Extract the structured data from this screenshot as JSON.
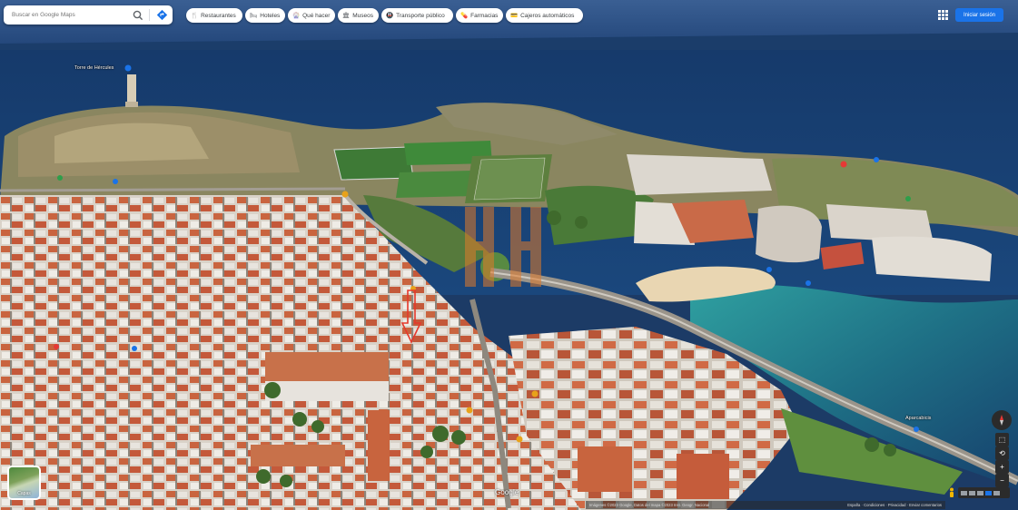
{
  "search": {
    "placeholder": "Buscar en Google Maps"
  },
  "chips": [
    {
      "icon": "🍴",
      "icon_name": "restaurant-icon",
      "label": "Restaurantes"
    },
    {
      "icon": "🛏",
      "icon_name": "hotel-icon",
      "label": "Hoteles"
    },
    {
      "icon": "🎡",
      "icon_name": "attraction-icon",
      "label": "Qué hacer"
    },
    {
      "icon": "🏛",
      "icon_name": "museum-icon",
      "label": "Museos"
    },
    {
      "icon": "🚇",
      "icon_name": "transit-icon",
      "label": "Transporte público"
    },
    {
      "icon": "💊",
      "icon_name": "pharmacy-icon",
      "label": "Farmacias"
    },
    {
      "icon": "💳",
      "icon_name": "atm-icon",
      "label": "Cajeros automáticos"
    }
  ],
  "header": {
    "signin_label": "Iniciar sesión"
  },
  "map": {
    "landmark_label": "Torre de Hércules",
    "parking_label": "Aparcabicis",
    "layer_label": "Capas",
    "google_logo": "Google",
    "footer_left": "Imágenes ©2023 Google, Datos del mapa ©2023 Inst. Geogr. Nacional",
    "footer_right": "España · Condiciones · Privacidad · Enviar comentarios",
    "colors": {
      "sea": "#1d3f6e",
      "bay": "#1f7f8a",
      "grass": "#6f8a45",
      "roofs": "#c86a45",
      "pointer_arrow": "#e5392b"
    }
  }
}
